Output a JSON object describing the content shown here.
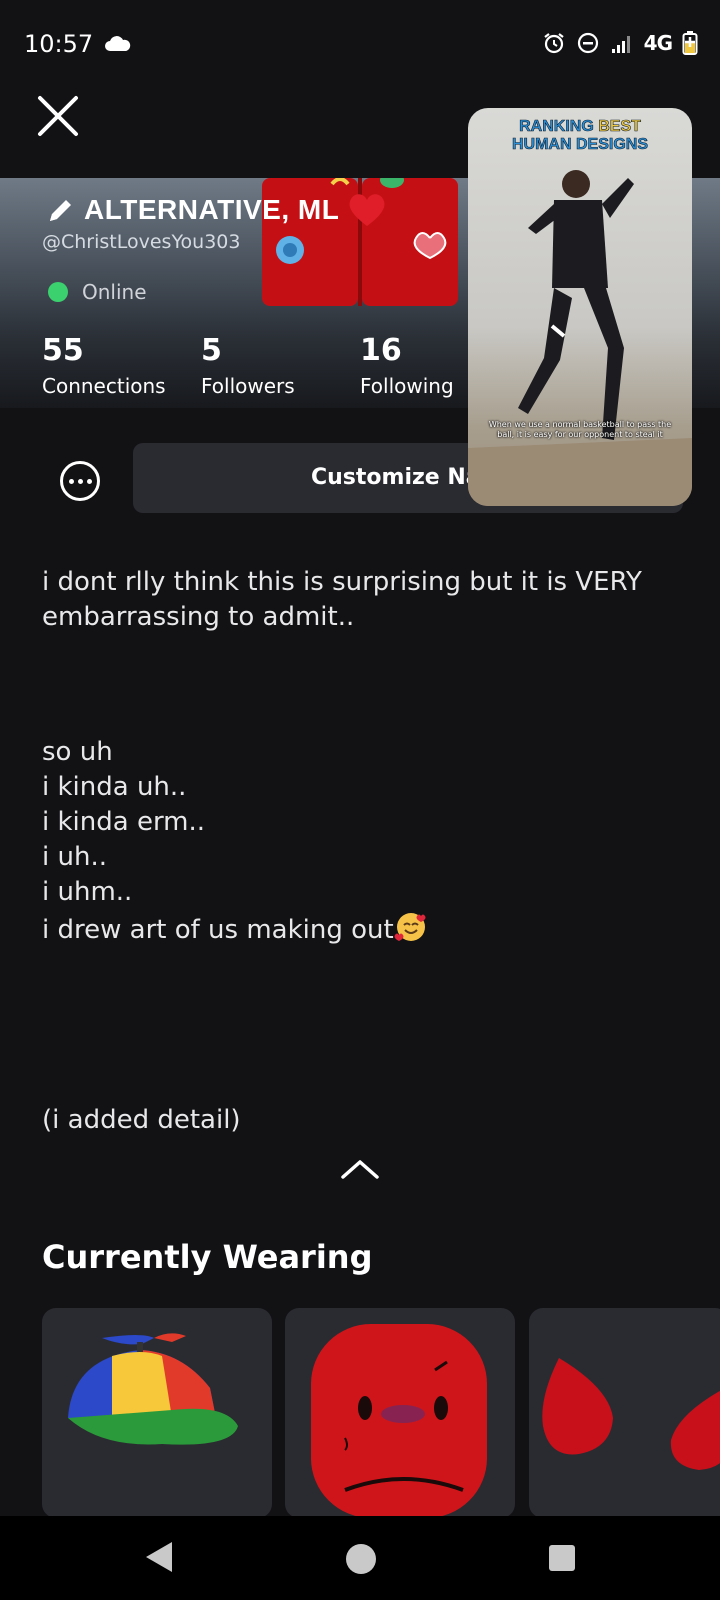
{
  "status_bar": {
    "time": "10:57",
    "network": "4G",
    "icons": [
      "cloud-icon",
      "alarm-icon",
      "dnd-icon",
      "signal-icon",
      "battery-icon"
    ]
  },
  "profile": {
    "display_name": "ALTERNATIVE, ML",
    "username": "@ChristLovesYou303",
    "status": "Online",
    "status_color": "#3bd16f",
    "stats": [
      {
        "value": "55",
        "label": "Connections"
      },
      {
        "value": "5",
        "label": "Followers"
      },
      {
        "value": "16",
        "label": "Following"
      }
    ]
  },
  "actions": {
    "customize_label": "Customize Name"
  },
  "pip_video": {
    "title_line1_a": "RANKING ",
    "title_line1_b": "BEST",
    "title_line2": "HUMAN DESIGNS",
    "caption": "When we use a normal basketball to pass the ball, it is easy for our opponent to steal it"
  },
  "bio": {
    "line1": "i dont rlly think this is surprising but it is VERY embarrassing to admit..",
    "lines2": [
      "so uh",
      "i kinda uh..",
      "i kinda erm..",
      "i uh..",
      "i uhm.."
    ],
    "line3": "i drew art of us making out",
    "line4": "(i added detail)"
  },
  "currently_wearing": {
    "title": "Currently Wearing",
    "items": [
      "propeller-hat",
      "red-head",
      "red-drops"
    ]
  },
  "colors": {
    "background": "#121215",
    "card": "#2a2b31",
    "accent_online": "#3bd16f"
  }
}
